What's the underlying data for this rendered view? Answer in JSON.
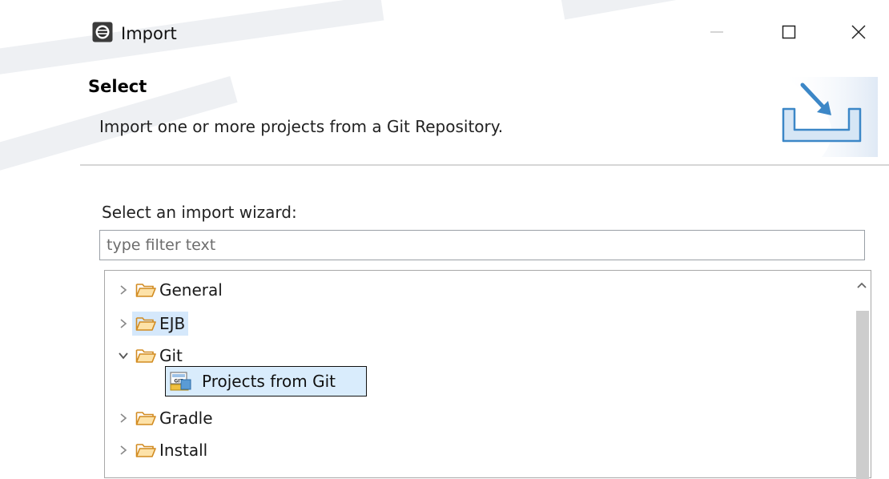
{
  "window": {
    "title": "Import",
    "icon": "eclipse-icon",
    "controls": {
      "minimize": "minimize-icon",
      "maximize": "maximize-icon",
      "close": "close-icon"
    }
  },
  "header": {
    "title": "Select",
    "description": "Import one or more projects from a Git Repository.",
    "graphic": "import-wizard-icon"
  },
  "wizard": {
    "label": "Select an import wizard:",
    "filter": {
      "placeholder": "type filter text",
      "value": ""
    },
    "tree": [
      {
        "label": "General",
        "expanded": false,
        "icon": "folder-icon"
      },
      {
        "label": "EJB",
        "expanded": false,
        "icon": "folder-icon",
        "highlighted": true
      },
      {
        "label": "Git",
        "expanded": true,
        "icon": "folder-icon",
        "children": [
          {
            "label": "Projects from Git",
            "icon": "git-projects-icon",
            "selected": true
          }
        ]
      },
      {
        "label": "Gradle",
        "expanded": false,
        "icon": "folder-icon"
      },
      {
        "label": "Install",
        "expanded": false,
        "icon": "folder-icon"
      }
    ]
  },
  "colors": {
    "accent": "#3c87c7",
    "selection": "#d9ecfc",
    "folder": "#e8a33a"
  }
}
